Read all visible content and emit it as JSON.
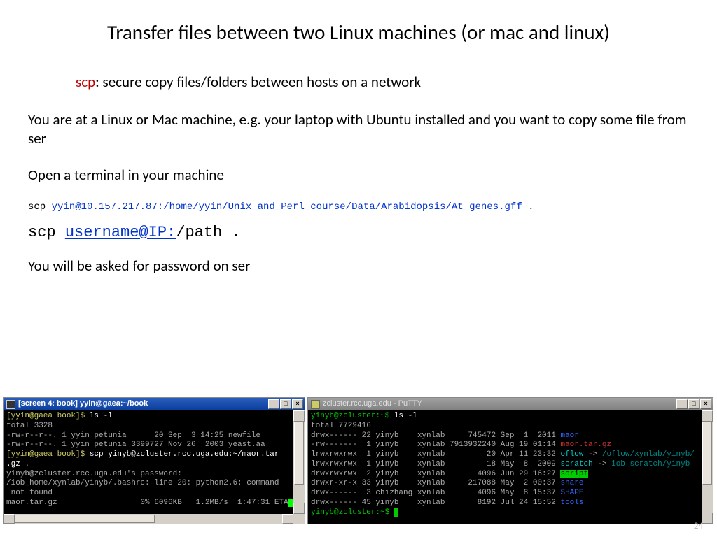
{
  "title": "Transfer files between two Linux machines (or mac and linux)",
  "subtitle_scp": "scp",
  "subtitle_rest": ": secure copy files/folders between hosts on a network",
  "para1": "You are at a Linux or Mac machine, e.g. your laptop with Ubuntu installed and you want to copy some file from ser",
  "para2": "Open a terminal in your machine",
  "cmd1_scp": "scp ",
  "cmd1_link": "yyin@10.157.217.87:/home/yyin/Unix_and_Perl_course/Data/Arabidopsis/At_genes.gff",
  "cmd1_end": " .",
  "cmd2_scp": "scp ",
  "cmd2_link": "username@IP:",
  "cmd2_path": "/path .",
  "para3": "You will be asked for password on ser",
  "page_number": "24",
  "term_left": {
    "title": "[screen 4: book] yyin@gaea:~/book",
    "min": "_",
    "max": "□",
    "close": "×",
    "l1_prompt": "[yyin@gaea book]$ ",
    "l1_cmd": "ls -l",
    "l2": "total 3328",
    "l3": "-rw-r--r--. 1 yyin petunia      20 Sep  3 14:25 newfile",
    "l4": "-rw-r--r--. 1 yyin petunia 3399727 Nov 26  2003 yeast.aa",
    "l5_prompt": "[yyin@gaea book]$ ",
    "l5_cmd": "scp yinyb@zcluster.rcc.uga.edu:~/maor.tar",
    "l6": ".gz .",
    "l7": "yinyb@zcluster.rcc.uga.edu's password:",
    "l8": "/iob_home/xynlab/yinyb/.bashrc: line 20: python2.6: command",
    "l9": " not found",
    "l10_a": "maor.tar.gz                  0% 6096KB   1.2MB/s  1:47:31 ETA",
    "l10_cursor": " "
  },
  "term_right": {
    "title": "zcluster.rcc.uga.edu - PuTTY",
    "min": "_",
    "max": "□",
    "close": "×",
    "l1_prompt": "yinyb@zcluster:~$ ",
    "l1_cmd": "ls -l",
    "l2": "total 7729416",
    "r1_a": "drwx------ 22 yinyb    xynlab     745472 Sep  1  2011 ",
    "r1_b": "maor",
    "r2_a": "-rw-------  1 yinyb    xynlab 7913932240 Aug 19 01:14 ",
    "r2_b": "maor.tar.gz",
    "r3_a": "lrwxrwxrwx  1 yinyb    xynlab         20 Apr 11 23:32 ",
    "r3_b": "oflow",
    "r3_c": " -> ",
    "r3_d": "/oflow/xynlab/yinyb/",
    "r4_a": "lrwxrwxrwx  1 yinyb    xynlab         18 May  8  2009 ",
    "r4_b": "scratch",
    "r4_c": " -> ",
    "r4_d": "iob_scratch/yinyb",
    "r5_a": "drwxrwxrwx  2 yinyb    xynlab       4096 Jun 29 16:27 ",
    "r5_b": "script",
    "r6_a": "drwxr-xr-x 33 yinyb    xynlab     217088 May  2 00:37 ",
    "r6_b": "share",
    "r7_a": "drwx------  3 chizhang xynlab       4096 May  8 15:37 ",
    "r7_b": "SHAPE",
    "r8_a": "drwx------ 45 yinyb    xynlab       8192 Jul 24 15:52 ",
    "r8_b": "tools",
    "lp_prompt": "yinyb@zcluster:~$ ",
    "lp_cursor": " "
  }
}
